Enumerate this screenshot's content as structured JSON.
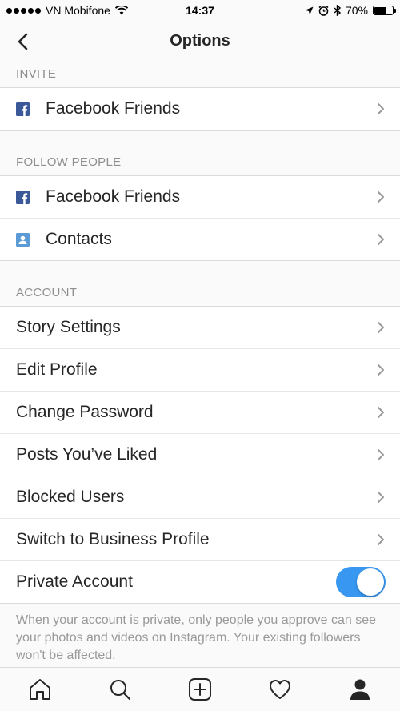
{
  "status_bar": {
    "carrier": "VN Mobifone",
    "time": "14:37",
    "battery_percent": "70%",
    "battery_level": 0.7,
    "icons": [
      "signal-dots-icon",
      "wifi-icon",
      "location-arrow-icon",
      "alarm-clock-icon",
      "bluetooth-icon",
      "battery-icon"
    ]
  },
  "nav": {
    "title": "Options",
    "back_icon": "chevron-left-icon"
  },
  "sections": {
    "invite": {
      "header": "INVITE",
      "items": [
        {
          "label": "Facebook Friends",
          "icon": "facebook-icon"
        }
      ]
    },
    "follow_people": {
      "header": "FOLLOW PEOPLE",
      "items": [
        {
          "label": "Facebook Friends",
          "icon": "facebook-icon"
        },
        {
          "label": "Contacts",
          "icon": "contacts-icon"
        }
      ]
    },
    "account": {
      "header": "ACCOUNT",
      "items": [
        {
          "label": "Story Settings"
        },
        {
          "label": "Edit Profile"
        },
        {
          "label": "Change Password"
        },
        {
          "label": "Posts You’ve Liked"
        },
        {
          "label": "Blocked Users"
        },
        {
          "label": "Switch to Business Profile"
        }
      ],
      "private_account": {
        "label": "Private Account",
        "enabled": true,
        "footnote": "When your account is private, only people you approve can see your photos and videos on Instagram. Your existing followers won't be affected."
      }
    }
  },
  "tab_bar": {
    "tabs": [
      "home-icon",
      "search-icon",
      "add-post-icon",
      "heart-icon",
      "profile-icon"
    ],
    "active": "profile-icon"
  },
  "colors": {
    "accent_blue": "#3897f0",
    "facebook_blue": "#3b5998",
    "contacts_blue": "#5b9bd5",
    "text": "#262626",
    "secondary_text": "#8e8e8e"
  }
}
